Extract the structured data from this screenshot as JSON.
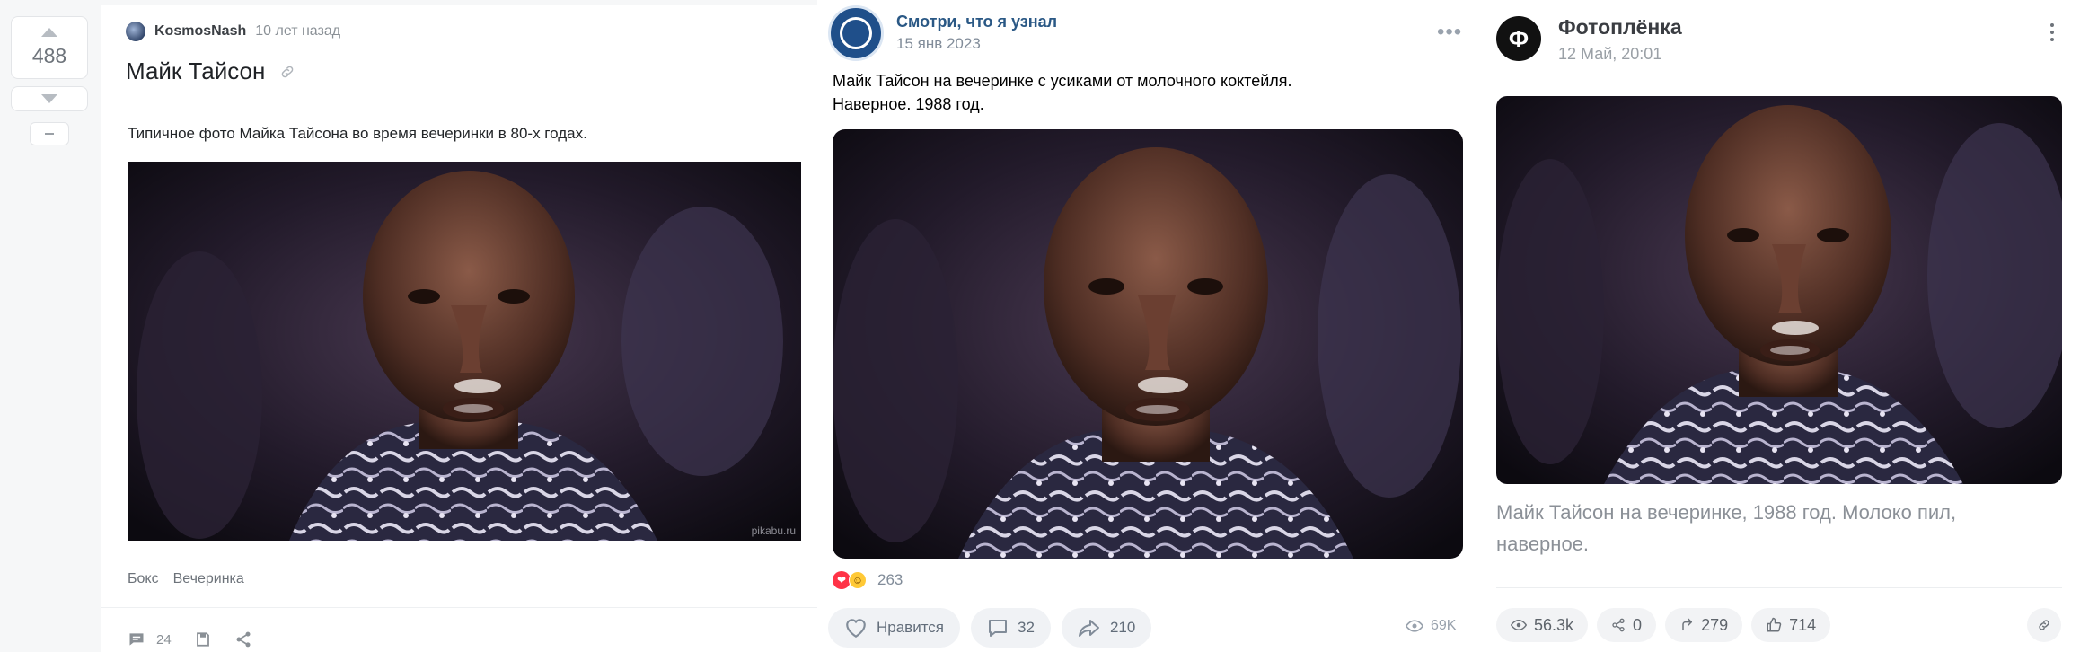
{
  "pikabu": {
    "rating": "488",
    "author": "KosmosNash",
    "time": "10 лет назад",
    "title": "Майк Тайсон",
    "text": "Типичное фото Майка Тайсона во время вечеринки в 80-х годах.",
    "watermark": "pikabu.ru",
    "tags": [
      "Бокс",
      "Вечеринка"
    ],
    "comments_count": "24"
  },
  "vk": {
    "group_name": "Смотри, что я узнал",
    "date": "15 янв 2023",
    "text_line1": "Майк Тайсон на вечеринке с усиками от молочного коктейля.",
    "text_line2": "Наверное. 1988 год.",
    "reactions_count": "263",
    "like_label": "Нравится",
    "comments_count": "32",
    "shares_count": "210",
    "views": "69K"
  },
  "dzen": {
    "channel_name": "Фотоплёнка",
    "logo_letter": "Ф",
    "date": "12 Май, 20:01",
    "text": "Майк Тайсон на вечеринке, 1988 год. Молоко пил, наверное.",
    "views": "56.3k",
    "reposts": "0",
    "shares": "279",
    "likes": "714"
  }
}
